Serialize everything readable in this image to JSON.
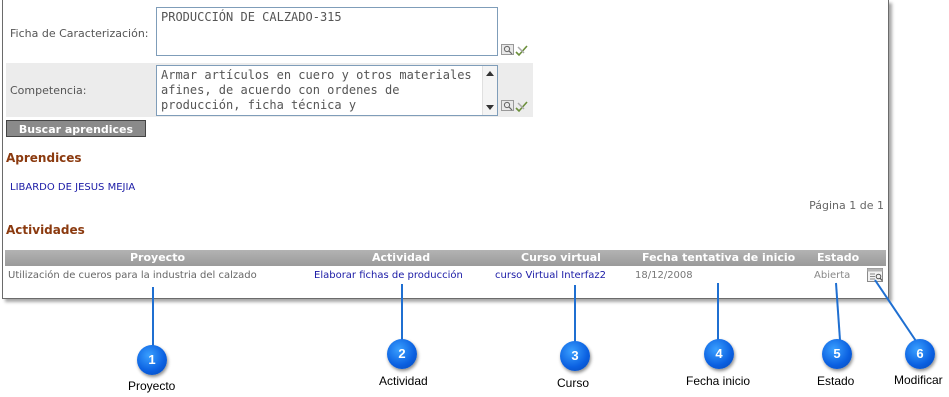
{
  "form": {
    "ficha_label": "Ficha de Caracterización:",
    "ficha_value": "PRODUCCIÓN DE CALZADO-315",
    "competencia_label": "Competencia:",
    "competencia_value": "Armar artículos en cuero y otros materiales afines, de acuerdo con ordenes de producción, ficha técnica y",
    "buscar_button": "Buscar aprendices"
  },
  "aprendices": {
    "title": "Aprendices",
    "items": [
      "LIBARDO DE JESUS MEJIA"
    ],
    "pagination": "Página 1 de 1"
  },
  "actividades": {
    "title": "Actividades",
    "columns": [
      "Proyecto",
      "Actividad",
      "Curso virtual",
      "Fecha tentativa de inicio",
      "Estado"
    ],
    "rows": [
      {
        "proyecto": "Utilización de cueros para la industria del calzado",
        "actividad": "Elaborar fichas de producción",
        "curso": "curso Virtual Interfaz2",
        "fecha": "18/12/2008",
        "estado": "Abierta"
      }
    ]
  },
  "callouts": [
    {
      "num": "1",
      "label": "Proyecto"
    },
    {
      "num": "2",
      "label": "Actividad"
    },
    {
      "num": "3",
      "label": "Curso"
    },
    {
      "num": "4",
      "label": "Fecha inicio"
    },
    {
      "num": "5",
      "label": "Estado"
    },
    {
      "num": "6",
      "label": "Modificar"
    }
  ],
  "colors": {
    "section_title": "#8b3a0f",
    "link": "#1a1aa6",
    "grid_header": "#a6a6a6",
    "callout_badge": "#0a5fe0"
  },
  "icons": [
    "search-lookup-icon",
    "pencil-check-icon",
    "edit-record-icon"
  ]
}
